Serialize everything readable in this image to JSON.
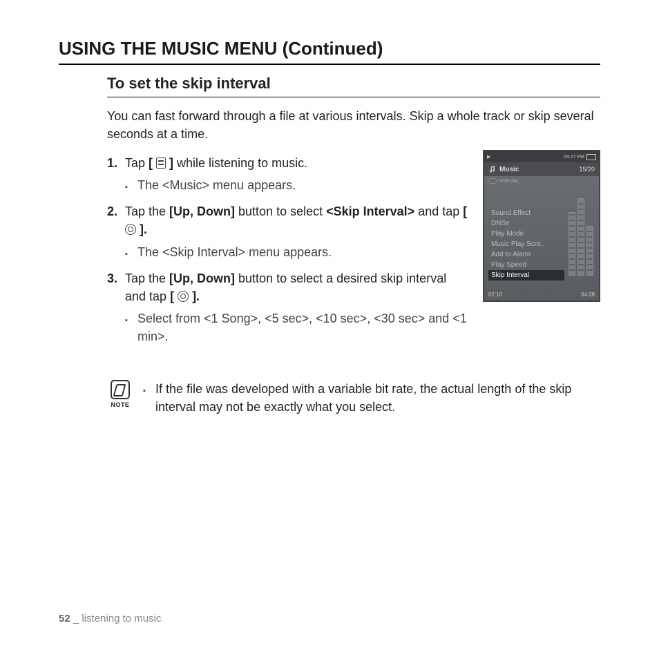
{
  "page": {
    "h1": "USING THE MUSIC MENU (Continued)",
    "h2": "To set the skip interval",
    "intro": "You can fast forward through a file at various intervals. Skip a whole track or skip several seconds at a time.",
    "steps": {
      "s1": {
        "num": "1.",
        "pre": "Tap ",
        "b1": "[ ",
        "b2": " ]",
        "post": " while listening to music."
      },
      "s1sub": "The <Music> menu appears.",
      "s2": {
        "num": "2.",
        "pre": "Tap the ",
        "b1": "[Up, Down]",
        "mid": " button to select ",
        "b2": "<Skip Interval>",
        "mid2": " and tap ",
        "b3": "[ ",
        "b4": " ].",
        "post": ""
      },
      "s2sub": "The <Skip Interval> menu appears.",
      "s3": {
        "num": "3.",
        "pre": "Tap the ",
        "b1": "[Up, Down]",
        "mid": " button to select a desired skip interval and tap ",
        "b2": "[ ",
        "b3": " ].",
        "post": ""
      },
      "s3sub": "Select from <1 Song>, <5 sec>, <10 sec>, <30 sec> and <1 min>."
    },
    "note": {
      "label": "NOTE",
      "text": "If the file was developed with a variable bit rate, the actual length of the skip interval may not be exactly what you select."
    },
    "footer": {
      "page": "52",
      "sep": " _ ",
      "chapter": "listening to music"
    }
  },
  "device": {
    "time": "04:27 PM",
    "title": "Music",
    "count": "15/20",
    "normal": "NORMAL",
    "menu": [
      "Sound Effect",
      "DNSe",
      "Play Mode",
      "Music Play Scre..",
      "Add to Alarm",
      "Play Speed",
      "Skip Interval"
    ],
    "selected": "Skip Interval",
    "elapsed": "02:10",
    "total": "04:28"
  }
}
